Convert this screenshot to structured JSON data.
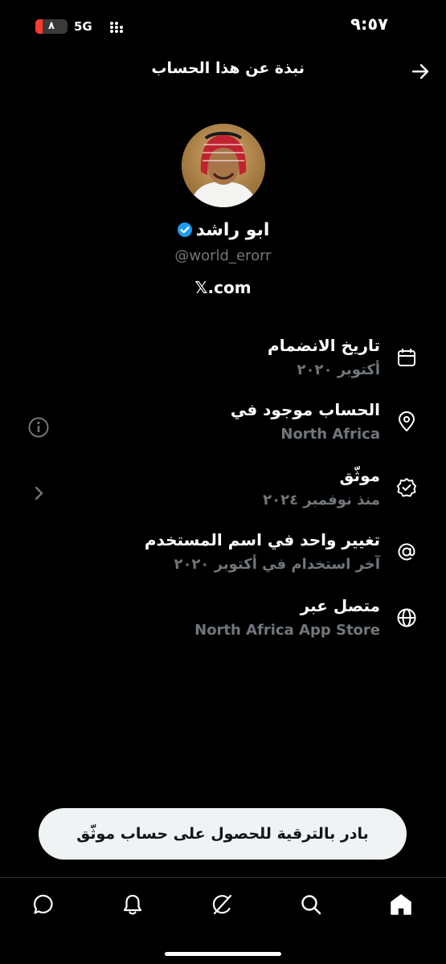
{
  "status_bar": {
    "time": "٩:٥٧",
    "battery": "٨",
    "battery_level": 0.22,
    "network": "5G"
  },
  "header": {
    "title": "نبذة عن هذا الحساب"
  },
  "profile": {
    "name": "ابو راشد",
    "handle": "@world_erorr",
    "site": "𝕏.com"
  },
  "rows": [
    {
      "icon": "calendar-icon",
      "title": "تاريخ الانضمام",
      "subtitle": "أكتوبر ٢٠٢٠"
    },
    {
      "icon": "location-icon",
      "title": "الحساب موجود في",
      "subtitle": "North Africa",
      "left_icon": "info-icon"
    },
    {
      "icon": "verified-badge-icon",
      "title": "موثّق",
      "subtitle": "منذ نوفمبر ٢٠٢٤",
      "left_icon": "chevron-icon"
    },
    {
      "icon": "at-icon",
      "title": "تغيير واحد في اسم المستخدم",
      "subtitle": "آخر استخدام في أكتوبر ٢٠٢٠"
    },
    {
      "icon": "globe-icon",
      "title": "متصل عبر",
      "subtitle": "North Africa App Store"
    }
  ],
  "upgrade": {
    "label": "بادر بالترقية للحصول على حساب موثّق"
  },
  "nav": [
    "messages-icon",
    "notifications-icon",
    "grok-icon",
    "search-icon",
    "home-icon"
  ],
  "colors": {
    "background": "#000000",
    "muted": "#71767b",
    "verified": "#1d9bf0",
    "button_bg": "#eff3f4"
  }
}
